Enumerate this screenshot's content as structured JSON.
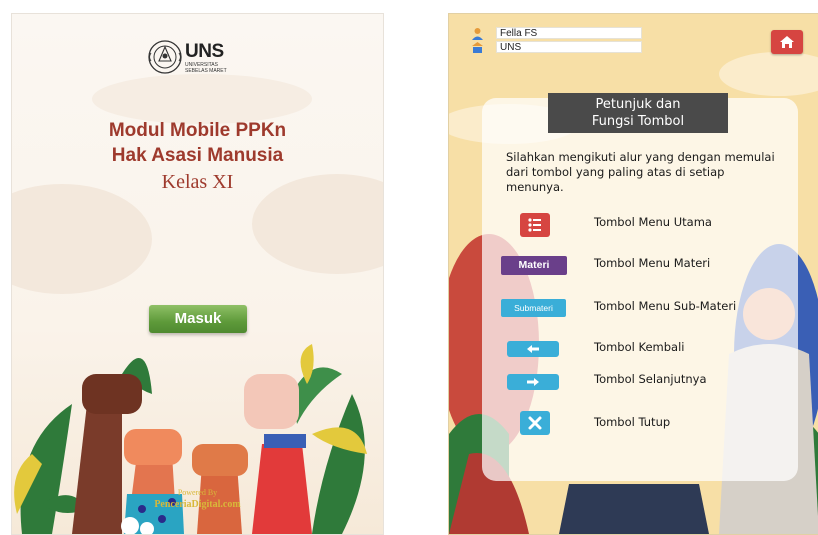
{
  "cover": {
    "logo_text": "UNS",
    "logo_subtext": "UNIVERSITAS SEBELAS MARET",
    "title_line1": "Modul Mobile PPKn",
    "title_line2": "Hak Asasi Manusia",
    "subtitle": "Kelas XI",
    "enter_button": "Masuk",
    "powered_by": "Powered By",
    "powered_name": "PenceriaDigital.com"
  },
  "guide": {
    "user_name": "Fella FS",
    "user_school": "UNS",
    "home_icon": "home-icon",
    "heading_line1": "Petunjuk dan",
    "heading_line2": "Fungsi Tombol",
    "intro": "Silahkan mengikuti alur yang dengan memulai dari tombol yang paling atas di setiap menunya.",
    "items": [
      {
        "button_label": "",
        "icon": "menu-list-icon",
        "description": "Tombol Menu Utama"
      },
      {
        "button_label": "Materi",
        "icon": "",
        "description": "Tombol Menu Materi"
      },
      {
        "button_label": "Submateri",
        "icon": "",
        "description": "Tombol Menu Sub-Materi"
      },
      {
        "button_label": "",
        "icon": "arrow-left-icon",
        "description": "Tombol Kembali"
      },
      {
        "button_label": "",
        "icon": "arrow-right-icon",
        "description": "Tombol Selanjutnya"
      },
      {
        "button_label": "",
        "icon": "close-icon",
        "description": "Tombol Tutup"
      }
    ]
  },
  "colors": {
    "title_red": "#9e3a2d",
    "green_button": "#5e9a3a",
    "red_button": "#d64541",
    "purple_button": "#6a3f8a",
    "blue_button": "#3aaed8",
    "panel_head": "#4a4a4a",
    "background_yellow": "#f7dfa6"
  }
}
